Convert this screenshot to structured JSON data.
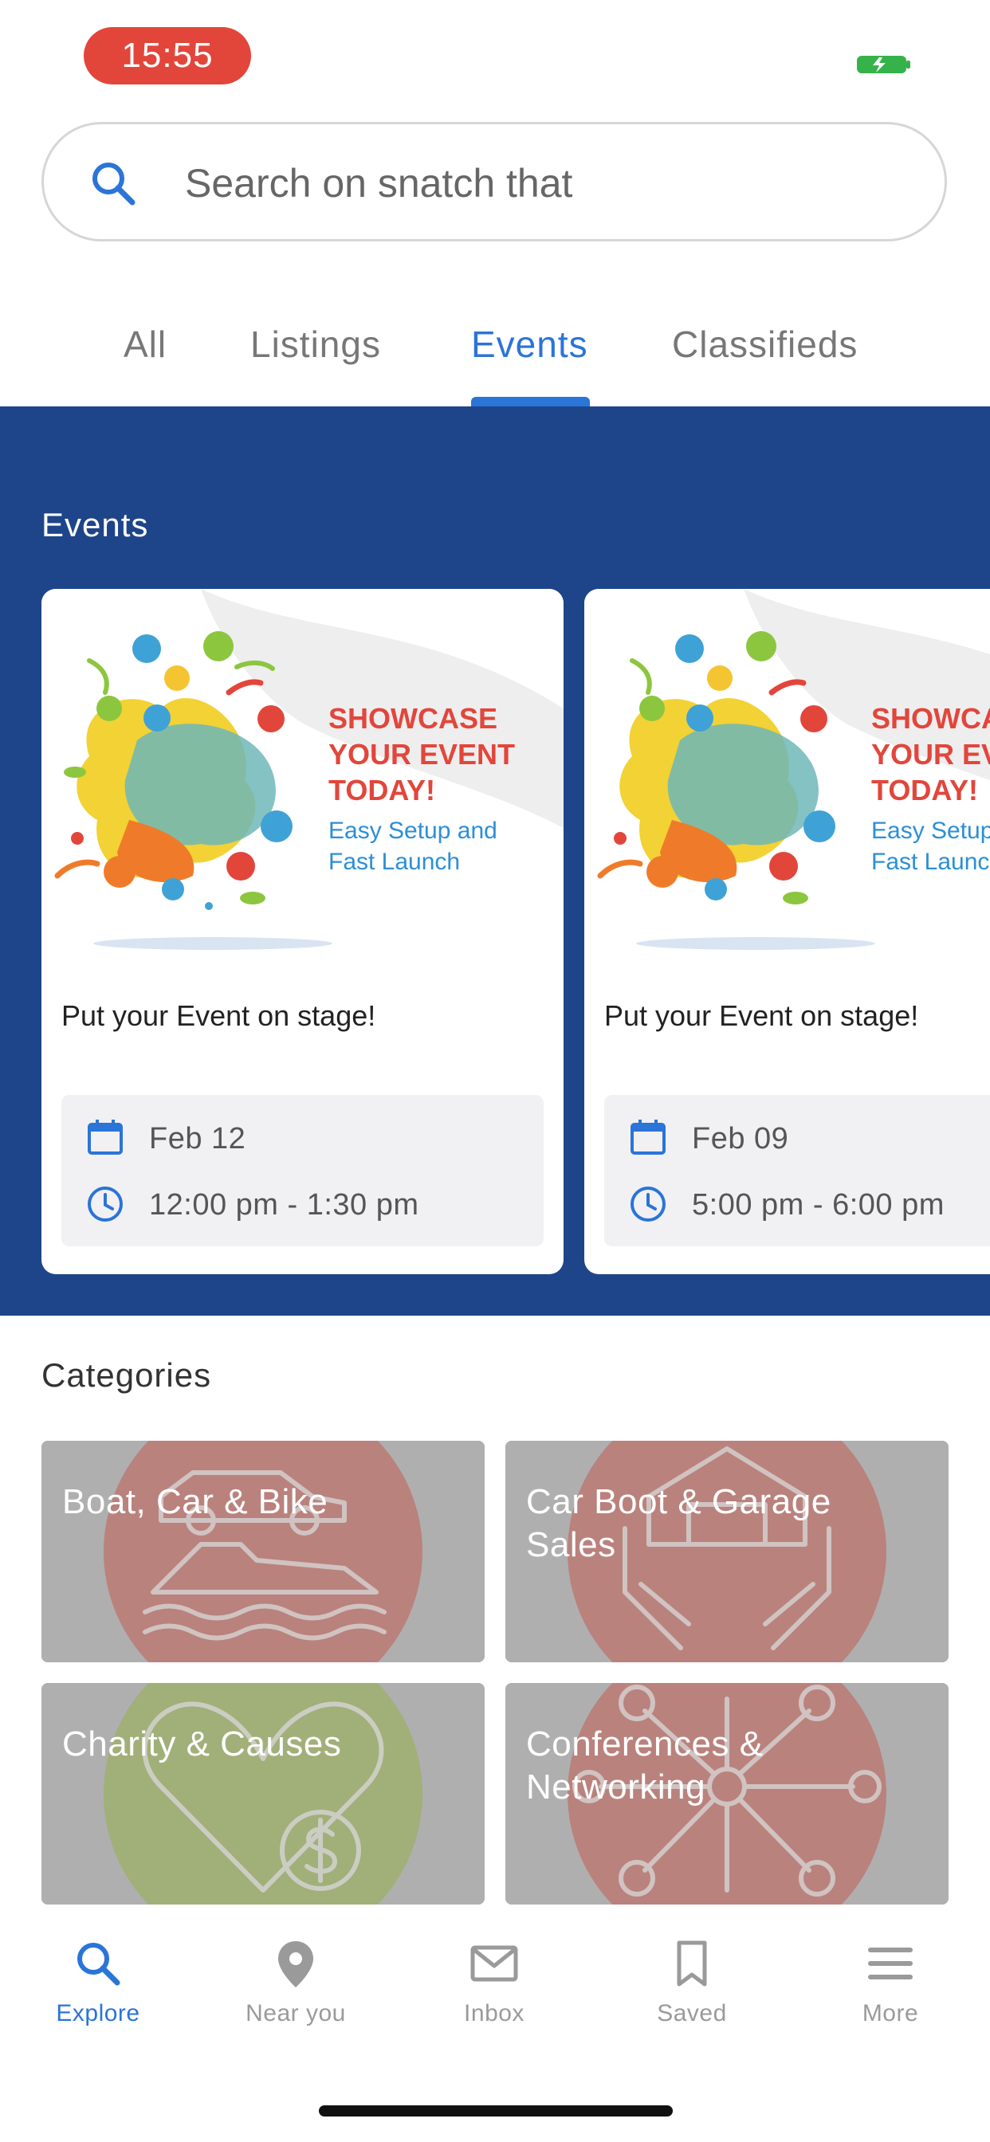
{
  "status_bar": {
    "time": "15:55"
  },
  "search": {
    "placeholder": "Search on snatch that"
  },
  "tabs": [
    {
      "label": "All",
      "active": false
    },
    {
      "label": "Listings",
      "active": false
    },
    {
      "label": "Events",
      "active": true
    },
    {
      "label": "Classifieds",
      "active": false
    }
  ],
  "events_section": {
    "title": "Events",
    "cards": [
      {
        "image_headline": [
          "SHOWCASE",
          "YOUR EVENT",
          "TODAY!"
        ],
        "image_subline": [
          "Easy Setup and",
          "Fast Launch"
        ],
        "title": "Put your Event on stage!",
        "date": "Feb 12",
        "time": "12:00 pm - 1:30 pm"
      },
      {
        "image_headline": [
          "SHOWCASE",
          "YOUR EVENT",
          "TODAY!"
        ],
        "image_subline": [
          "Easy Setup and",
          "Fast Launch"
        ],
        "title": "Put your Event on stage!",
        "date": "Feb 09",
        "time": "5:00 pm - 6:00 pm"
      }
    ]
  },
  "categories_section": {
    "title": "Categories",
    "items": [
      {
        "label": "Boat, Car & Bike",
        "icon": "car-boat-icon",
        "color": "#c0453a"
      },
      {
        "label": "Car Boot & Garage Sales",
        "icon": "hands-house-icon",
        "color": "#c0453a"
      },
      {
        "label": "Charity & Causes",
        "icon": "heart-dollar-icon",
        "color": "#8aa832"
      },
      {
        "label": "Conferences & Networking",
        "icon": "network-icon",
        "color": "#c0453a"
      }
    ]
  },
  "bottom_nav": [
    {
      "label": "Explore",
      "icon": "search-icon",
      "active": true
    },
    {
      "label": "Near you",
      "icon": "location-pin-icon",
      "active": false
    },
    {
      "label": "Inbox",
      "icon": "mail-icon",
      "active": false
    },
    {
      "label": "Saved",
      "icon": "bookmark-icon",
      "active": false
    },
    {
      "label": "More",
      "icon": "menu-icon",
      "active": false
    }
  ],
  "colors": {
    "accent": "#2b74d8",
    "events_background": "#1e4589",
    "time_badge": "#e2463b",
    "promo_headline": "#e2463b",
    "promo_subline": "#2b8fd6"
  }
}
